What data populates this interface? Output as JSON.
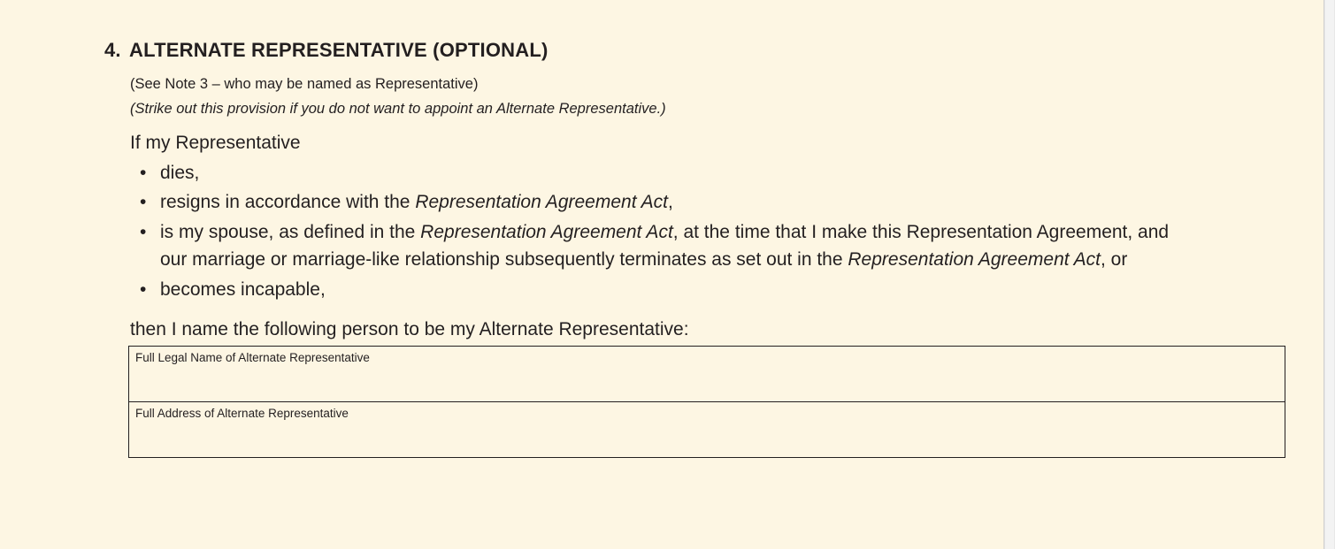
{
  "section": {
    "number": "4.",
    "title": "ALTERNATE REPRESENTATIVE (OPTIONAL)",
    "note": "(See Note 3 – who may be named as Representative)",
    "instruction": "(Strike out this provision if you do not want to appoint an Alternate Representative.)"
  },
  "body": {
    "intro": "If my Representative",
    "bullet_glyph": "•",
    "bullets": [
      {
        "text": "dies,"
      },
      {
        "before": "resigns in accordance with the ",
        "italic": "Representation Agreement Act",
        "after": ","
      },
      {
        "before": "is my spouse, as defined in the ",
        "italic": "Representation Agreement Act",
        "after": ", at the time that I make this Representation Agreement, and"
      },
      {
        "before": "our marriage or marriage-like relationship subsequently terminates as set out in the ",
        "italic": "Representation Agreement Act",
        "after": ", or"
      },
      {
        "text": "becomes incapable,"
      }
    ],
    "lead_out": "then I name the following person to be my Alternate Representative:"
  },
  "form": {
    "name_label": "Full Legal Name of Alternate Representative",
    "name_value": "",
    "address_label": "Full Address of Alternate Representative",
    "address_value": ""
  },
  "colors": {
    "background": "#fdf6e3",
    "text": "#231f20"
  }
}
